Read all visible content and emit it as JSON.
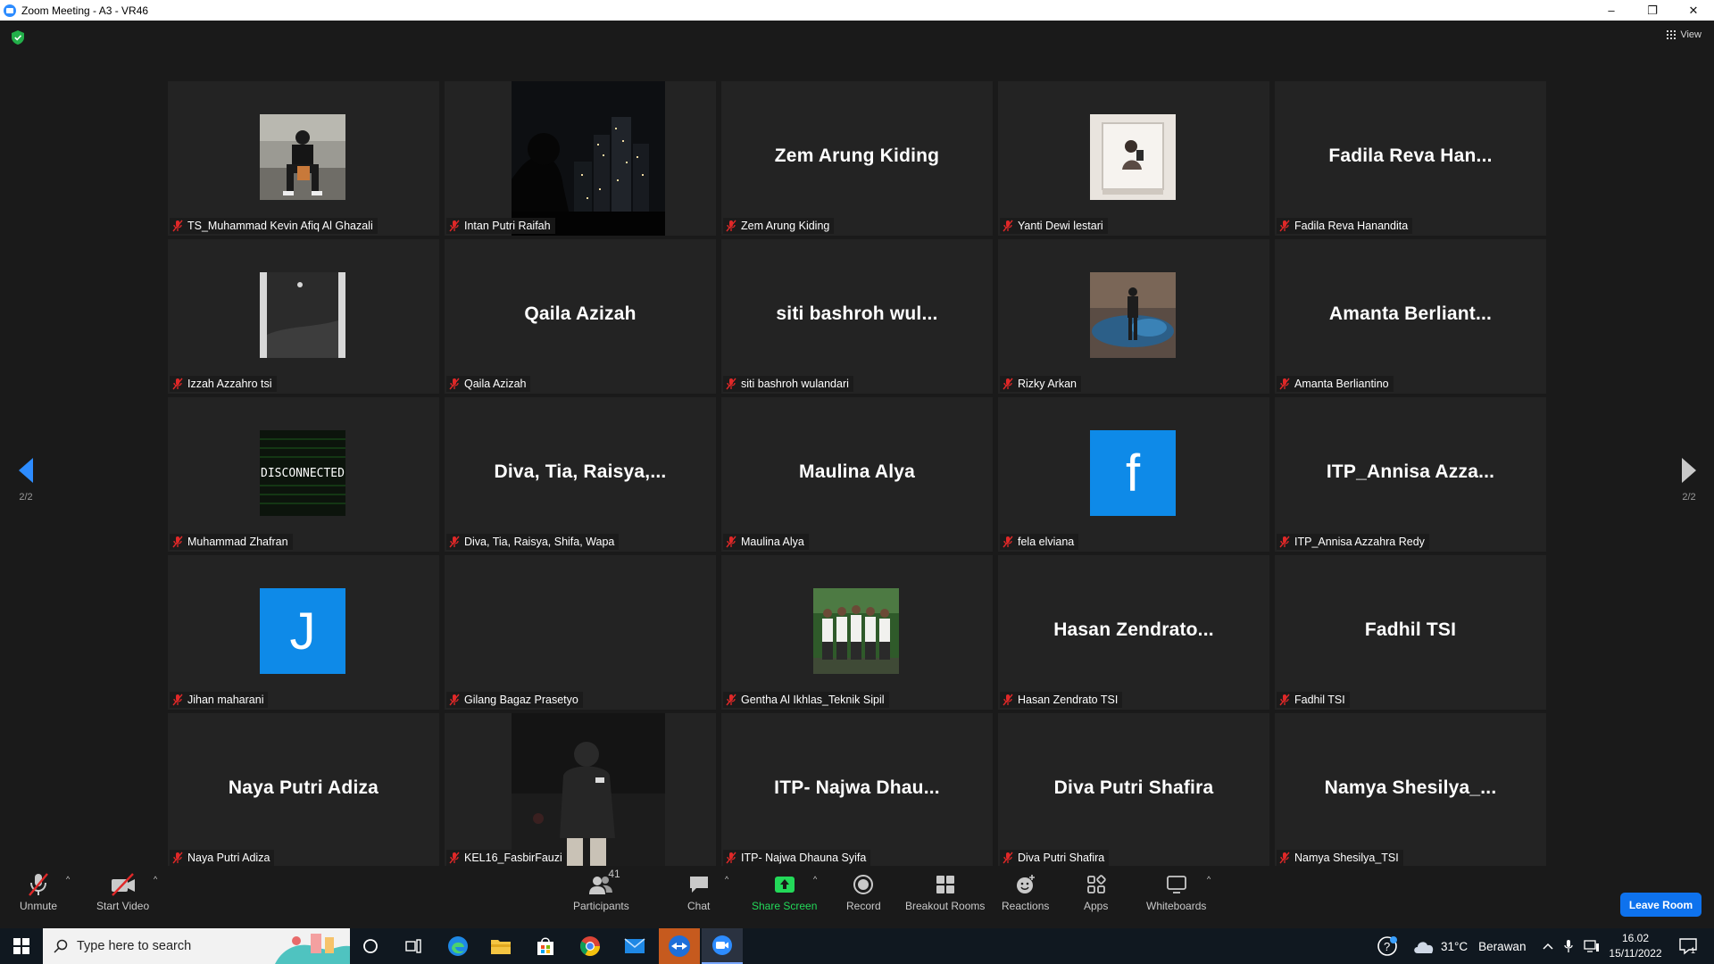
{
  "window": {
    "title": "Zoom Meeting - A3 - VR46",
    "minimize": "–",
    "restore": "❐",
    "close": "✕"
  },
  "meeting": {
    "view_label": "View",
    "page_indicator_left": "2/2",
    "page_indicator_right": "2/2",
    "tiles": [
      {
        "name": "TS_Muhammad Kevin Afiq Al Ghazali",
        "display": "",
        "kind": "photo-person"
      },
      {
        "name": "Intan Putri Raifah",
        "display": "",
        "kind": "video-city"
      },
      {
        "name": "Zem Arung Kiding",
        "display": "Zem Arung Kiding",
        "kind": "name"
      },
      {
        "name": "Yanti Dewi lestari",
        "display": "",
        "kind": "photo-mirror"
      },
      {
        "name": "Fadila Reva Hanandita",
        "display": "Fadila Reva Han...",
        "kind": "name"
      },
      {
        "name": "Izzah Azzahro tsi",
        "display": "",
        "kind": "photo-moon"
      },
      {
        "name": "Qaila Azizah",
        "display": "Qaila Azizah",
        "kind": "name"
      },
      {
        "name": "siti bashroh wulandari",
        "display": "siti bashroh wul...",
        "kind": "name"
      },
      {
        "name": "Rizky Arkan",
        "display": "",
        "kind": "photo-pool"
      },
      {
        "name": "Amanta Berliantino",
        "display": "Amanta Berliant...",
        "kind": "name"
      },
      {
        "name": "Muhammad Zhafran",
        "display": "DISCONNECTED",
        "kind": "photo-disconnected"
      },
      {
        "name": "Diva, Tia, Raisya, Shifa, Wapa",
        "display": "Diva, Tia, Raisya,...",
        "kind": "name"
      },
      {
        "name": "Maulina Alya",
        "display": "Maulina Alya",
        "kind": "name"
      },
      {
        "name": "fela elviana",
        "display": "f",
        "kind": "letter"
      },
      {
        "name": "ITP_Annisa Azzahra Redy",
        "display": "ITP_Annisa Azza...",
        "kind": "name"
      },
      {
        "name": "Jihan maharani",
        "display": "J",
        "kind": "letter"
      },
      {
        "name": "Gilang Bagaz Prasetyo",
        "display": "",
        "kind": "blank"
      },
      {
        "name": "Gentha Al Ikhlas_Teknik Sipil",
        "display": "",
        "kind": "photo-group"
      },
      {
        "name": "Hasan Zendrato TSI",
        "display": "Hasan Zendrato...",
        "kind": "name"
      },
      {
        "name": "Fadhil TSI",
        "display": "Fadhil TSI",
        "kind": "name"
      },
      {
        "name": "Naya Putri Adiza",
        "display": "Naya Putri Adiza",
        "kind": "name"
      },
      {
        "name": "KEL16_FasbirFauzi",
        "display": "",
        "kind": "video-night"
      },
      {
        "name": "ITP- Najwa Dhauna Syifa",
        "display": "ITP- Najwa Dhau...",
        "kind": "name"
      },
      {
        "name": "Diva Putri Shafira",
        "display": "Diva Putri Shafira",
        "kind": "name"
      },
      {
        "name": "Namya Shesilya_TSI",
        "display": "Namya Shesilya_...",
        "kind": "name"
      }
    ]
  },
  "toolbar": {
    "unmute": "Unmute",
    "start_video": "Start Video",
    "participants": "Participants",
    "participants_count": "41",
    "chat": "Chat",
    "share_screen": "Share Screen",
    "record": "Record",
    "breakout_rooms": "Breakout Rooms",
    "reactions": "Reactions",
    "apps": "Apps",
    "whiteboards": "Whiteboards",
    "leave_room": "Leave Room",
    "caret": "^"
  },
  "taskbar": {
    "search_placeholder": "Type here to search",
    "weather_temp": "31°C",
    "weather_desc": "Berawan",
    "time": "16.02",
    "date": "15/11/2022",
    "notification_count": "1"
  },
  "colors": {
    "accent": "#0e72ed",
    "share_green": "#23d959",
    "mic_off_red": "#e02828",
    "tile_bg": "#232323"
  }
}
